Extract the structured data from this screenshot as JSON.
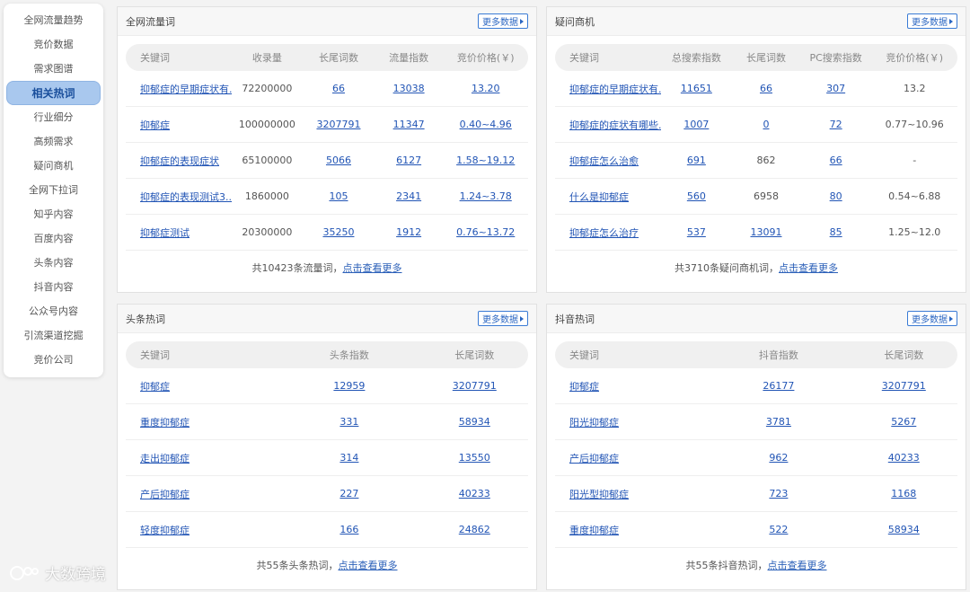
{
  "sidebar": {
    "items": [
      {
        "label": "全网流量趋势"
      },
      {
        "label": "竞价数据"
      },
      {
        "label": "需求图谱"
      },
      {
        "label": "相关热词",
        "active": true
      },
      {
        "label": "行业细分"
      },
      {
        "label": "高频需求"
      },
      {
        "label": "疑问商机"
      },
      {
        "label": "全网下拉词"
      },
      {
        "label": "知乎内容"
      },
      {
        "label": "百度内容"
      },
      {
        "label": "头条内容"
      },
      {
        "label": "抖音内容"
      },
      {
        "label": "公众号内容"
      },
      {
        "label": "引流渠道挖掘"
      },
      {
        "label": "竞价公司"
      }
    ]
  },
  "more_label": "更多数据",
  "panels": {
    "traffic": {
      "title": "全网流量词",
      "headers": [
        "关键词",
        "收录量",
        "长尾词数",
        "流量指数",
        "竞价价格(￥)"
      ],
      "rows": [
        [
          "抑郁症的早期症状有...",
          "72200000",
          "66",
          "13038",
          "13.20"
        ],
        [
          "抑郁症",
          "100000000",
          "3207791",
          "11347",
          "0.40~4.96"
        ],
        [
          "抑郁症的表现症状",
          "65100000",
          "5066",
          "6127",
          "1.58~19.12"
        ],
        [
          "抑郁症的表现测试3...",
          "1860000",
          "105",
          "2341",
          "1.24~3.78"
        ],
        [
          "抑郁症测试",
          "20300000",
          "35250",
          "1912",
          "0.76~13.72"
        ]
      ],
      "footer_prefix": "共10423条流量词，",
      "footer_link": "点击查看更多"
    },
    "question": {
      "title": "疑问商机",
      "headers": [
        "关键词",
        "总搜索指数",
        "长尾词数",
        "PC搜索指数",
        "竞价价格(￥)"
      ],
      "rows": [
        [
          "抑郁症的早期症状有...",
          "11651",
          "66",
          "307",
          "13.2"
        ],
        [
          "抑郁症的症状有哪些...",
          "1007",
          "0",
          "72",
          "0.77~10.96"
        ],
        [
          "抑郁症怎么治愈",
          "691",
          "862",
          "66",
          "-"
        ],
        [
          "什么是抑郁症",
          "560",
          "6958",
          "80",
          "0.54~6.88"
        ],
        [
          "抑郁症怎么治疗",
          "537",
          "13091",
          "85",
          "1.25~12.0"
        ]
      ],
      "footer_prefix": "共3710条疑问商机词，",
      "footer_link": "点击查看更多"
    },
    "toutiao": {
      "title": "头条热词",
      "headers": [
        "关键词",
        "头条指数",
        "长尾词数"
      ],
      "rows": [
        [
          "抑郁症",
          "12959",
          "3207791"
        ],
        [
          "重度抑郁症",
          "331",
          "58934"
        ],
        [
          "走出抑郁症",
          "314",
          "13550"
        ],
        [
          "产后抑郁症",
          "227",
          "40233"
        ],
        [
          "轻度抑郁症",
          "166",
          "24862"
        ]
      ],
      "footer_prefix": "共55条头条热词，",
      "footer_link": "点击查看更多"
    },
    "douyin": {
      "title": "抖音热词",
      "headers": [
        "关键词",
        "抖音指数",
        "长尾词数"
      ],
      "rows": [
        [
          "抑郁症",
          "26177",
          "3207791"
        ],
        [
          "阳光抑郁症",
          "3781",
          "5267"
        ],
        [
          "产后抑郁症",
          "962",
          "40233"
        ],
        [
          "阳光型抑郁症",
          "723",
          "1168"
        ],
        [
          "重度抑郁症",
          "522",
          "58934"
        ]
      ],
      "footer_prefix": "共55条抖音热词，",
      "footer_link": "点击查看更多"
    }
  },
  "watermark": {
    "text": "大数跨境"
  }
}
